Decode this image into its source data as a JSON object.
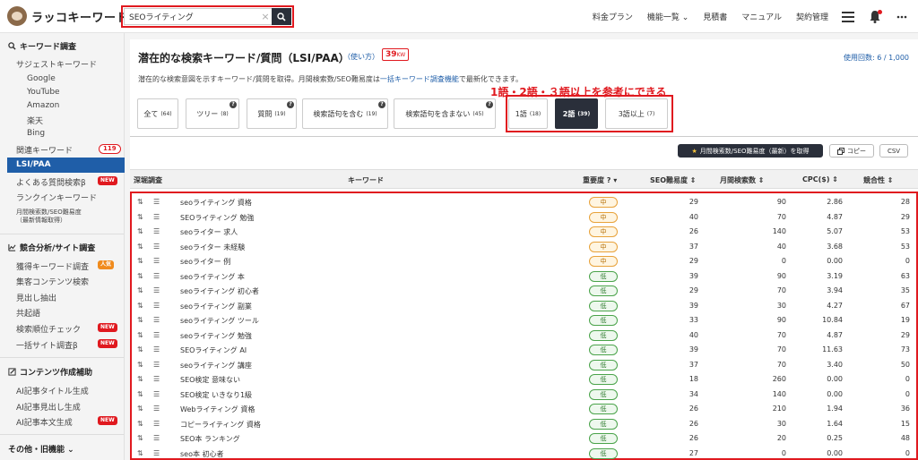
{
  "header": {
    "logo_text": "ラッコキーワード",
    "search_value": "SEOライティング",
    "nav": [
      "料金プラン",
      "機能一覧 ⌄",
      "見積書",
      "マニュアル",
      "契約管理"
    ]
  },
  "sidebar": {
    "section1": "キーワード調査",
    "suggest": "サジェストキーワード",
    "engines": [
      "Google",
      "YouTube",
      "Amazon",
      "楽天",
      "Bing"
    ],
    "related": "関連キーワード",
    "related_count": "119",
    "lsi": "LSI/PAA",
    "faq": "よくある質問検索β",
    "rankin": "ランクインキーワード",
    "monthly_line1": "月間検索数/SEO難易度",
    "monthly_line2": "（最新情報取得）",
    "section2": "競合分析/サイト調査",
    "acquired": "獲得キーワード調査",
    "pop_badge": "人気",
    "content_search": "集客コンテンツ検索",
    "headings": "見出し抽出",
    "cooccur": "共起語",
    "rank_check": "検索順位チェック",
    "bulk_site": "一括サイト調査β",
    "section3": "コンテンツ作成補助",
    "ai_title": "AI記事タイトル生成",
    "ai_heading": "AI記事見出し生成",
    "ai_body": "AI記事本文生成",
    "section4": "その他・旧機能 ⌄",
    "new_badge": "NEW"
  },
  "main": {
    "title": "潜在的な検索キーワード/質問（LSI/PAA）",
    "usage_link": "（使い方）",
    "kw_count": "39",
    "kw_unit": "KW",
    "usage_count": "使用回数: 6 / 1,000",
    "desc_pre": "潜在的な検索意図を示すキーワード/質問を取得。月間検索数/SEO難易度は",
    "desc_link": "一括キーワード調査機能",
    "desc_post": "で最新化できます。",
    "annotation": "1語・2語・３語以上を参考にできる",
    "tabs": [
      {
        "label": "全て",
        "count": "(64)"
      },
      {
        "label": "ツリー",
        "count": "(8)"
      },
      {
        "label": "質問",
        "count": "(19)"
      },
      {
        "label": "検索語句を含む",
        "count": "(19)"
      },
      {
        "label": "検索語句を含まない",
        "count": "(45)"
      },
      {
        "label": "1語",
        "count": "(18)"
      },
      {
        "label": "2語",
        "count": "(39)"
      },
      {
        "label": "3語以上",
        "count": "(7)"
      }
    ],
    "btn_fetch": "月間検索数/SEO難易度（最新）を取得",
    "btn_copy": "コピー",
    "btn_csv": "CSV",
    "columns": [
      "深堀調査",
      "キーワード",
      "重要度",
      "SEO難易度 ⇕",
      "月間検索数 ⇕",
      "CPC($) ⇕",
      "競合性 ⇕"
    ],
    "rows": [
      {
        "kw": "seoライティング 資格",
        "imp": "中",
        "seo": "29",
        "vol": "90",
        "cpc": "2.86",
        "comp": "28"
      },
      {
        "kw": "SEOライティング 勉強",
        "imp": "中",
        "seo": "40",
        "vol": "70",
        "cpc": "4.87",
        "comp": "29"
      },
      {
        "kw": "seoライター 求人",
        "imp": "中",
        "seo": "26",
        "vol": "140",
        "cpc": "5.07",
        "comp": "53"
      },
      {
        "kw": "seoライター 未経験",
        "imp": "中",
        "seo": "37",
        "vol": "40",
        "cpc": "3.68",
        "comp": "53"
      },
      {
        "kw": "seoライター 例",
        "imp": "中",
        "seo": "29",
        "vol": "0",
        "cpc": "0.00",
        "comp": "0"
      },
      {
        "kw": "seoライティング 本",
        "imp": "低",
        "seo": "39",
        "vol": "90",
        "cpc": "3.19",
        "comp": "63"
      },
      {
        "kw": "seoライティング 初心者",
        "imp": "低",
        "seo": "29",
        "vol": "70",
        "cpc": "3.94",
        "comp": "35"
      },
      {
        "kw": "seoライティング 副業",
        "imp": "低",
        "seo": "39",
        "vol": "30",
        "cpc": "4.27",
        "comp": "67"
      },
      {
        "kw": "seoライティング ツール",
        "imp": "低",
        "seo": "33",
        "vol": "90",
        "cpc": "10.84",
        "comp": "19"
      },
      {
        "kw": "seoライティング 勉強",
        "imp": "低",
        "seo": "40",
        "vol": "70",
        "cpc": "4.87",
        "comp": "29"
      },
      {
        "kw": "SEOライティング AI",
        "imp": "低",
        "seo": "39",
        "vol": "70",
        "cpc": "11.63",
        "comp": "73"
      },
      {
        "kw": "seoライティング 講座",
        "imp": "低",
        "seo": "37",
        "vol": "70",
        "cpc": "3.40",
        "comp": "50"
      },
      {
        "kw": "SEO検定 意味ない",
        "imp": "低",
        "seo": "18",
        "vol": "260",
        "cpc": "0.00",
        "comp": "0"
      },
      {
        "kw": "SEO検定 いきなり1級",
        "imp": "低",
        "seo": "34",
        "vol": "140",
        "cpc": "0.00",
        "comp": "0"
      },
      {
        "kw": "Webライティング 資格",
        "imp": "低",
        "seo": "26",
        "vol": "210",
        "cpc": "1.94",
        "comp": "36"
      },
      {
        "kw": "コピーライティング 資格",
        "imp": "低",
        "seo": "26",
        "vol": "30",
        "cpc": "1.64",
        "comp": "15"
      },
      {
        "kw": "SEO本 ランキング",
        "imp": "低",
        "seo": "26",
        "vol": "20",
        "cpc": "0.25",
        "comp": "48"
      },
      {
        "kw": "seo本 初心者",
        "imp": "低",
        "seo": "27",
        "vol": "0",
        "cpc": "0.00",
        "comp": "0"
      }
    ]
  },
  "colors": {
    "accent": "#1f5ea8",
    "highlight": "#e0191f",
    "dark": "#2a2f3a"
  }
}
